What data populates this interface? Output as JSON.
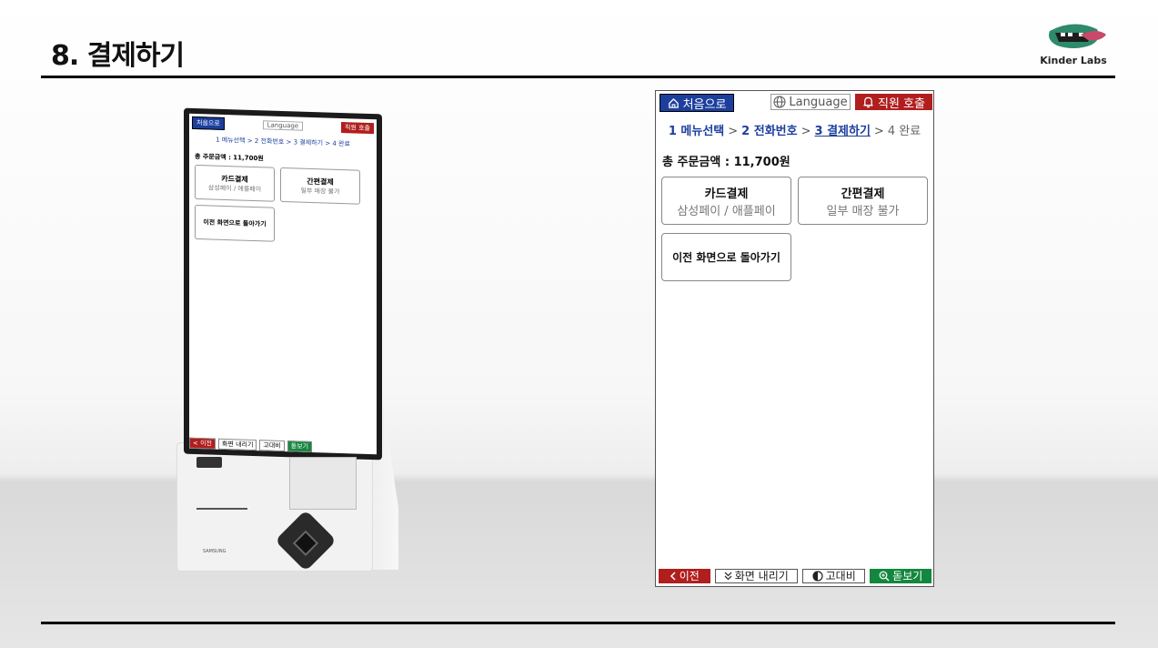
{
  "slide": {
    "title": "8. 결제하기",
    "logo_text": "Kinder Labs"
  },
  "kiosk_preview": {
    "home": "처음으로",
    "language": "Language",
    "call": "직원 호출",
    "breadcrumb": "1 메뉴선택  >  2 전화번호  >  3 결제하기  >  4 완료",
    "total": "총 주문금액 : 11,700원",
    "card_title": "카드결제",
    "card_sub": "삼성페이 / 애플페이",
    "easy_title": "간편결제",
    "easy_sub": "일부 매장 불가",
    "back": "이전 화면으로 돌아가기",
    "prev": "< 이전",
    "scroll": "화면 내리기",
    "contrast": "고대비",
    "zoom": "돋보기",
    "brand": "SAMSUNG"
  },
  "screen": {
    "top_bar": {
      "home_label": "처음으로",
      "language_label": "Language",
      "call_label": "직원 호출"
    },
    "breadcrumb": {
      "step1": "1 메뉴선택",
      "step2": "2 전화번호",
      "step3": "3 결제하기",
      "step4": "4 완료",
      "separator": ">"
    },
    "total_label": "총 주문금액 : 11,700원",
    "payment_options": {
      "card": {
        "title": "카드결제",
        "subtitle": "삼성페이 / 애플페이"
      },
      "easy": {
        "title": "간편결제",
        "subtitle": "일부 매장 불가"
      }
    },
    "back_button": "이전 화면으로 돌아가기",
    "bottom_bar": {
      "prev_label": "이전",
      "scroll_label": "화면 내리기",
      "contrast_label": "고대비",
      "zoom_label": "돋보기"
    }
  },
  "colors": {
    "home_blue": "#1c3f9e",
    "call_red": "#b11e1e",
    "zoom_green": "#14873f"
  }
}
